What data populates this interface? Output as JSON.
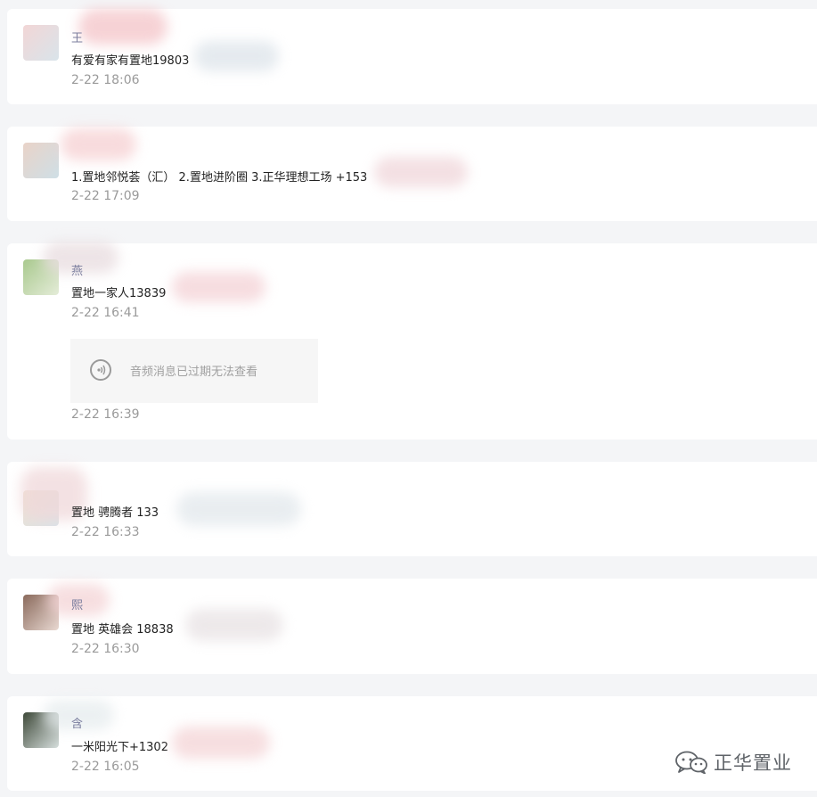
{
  "messages": [
    {
      "name": "王",
      "text": "有爱有家有置地19803",
      "time": "2-22 18:06"
    },
    {
      "name": "",
      "text": "1.置地邻悦荟（汇） 2.置地进阶圈 3.正华理想工场 +153",
      "time": "2-22 17:09"
    },
    {
      "name": "燕",
      "text": "置地一家人13839",
      "time": "2-22 16:41",
      "audio_text": "音频消息已过期无法查看",
      "audio_time": "2-22 16:39"
    },
    {
      "name": "",
      "text": "置地   骋腾者  133",
      "time": "2-22 16:33"
    },
    {
      "name": "熙",
      "text": "置地  英雄会 18838",
      "time": "2-22 16:30"
    },
    {
      "name": "含",
      "text": "一米阳光下+1302",
      "time": "2-22 16:05"
    }
  ],
  "watermark": {
    "text": "正华置业",
    "icon": "wechat-icon"
  }
}
